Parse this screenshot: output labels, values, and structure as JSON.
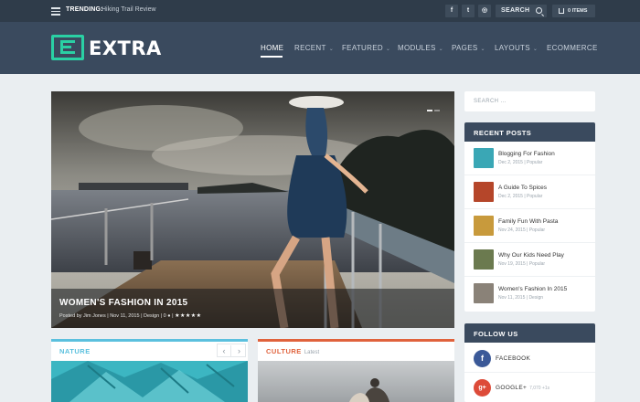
{
  "topbar": {
    "trending_label": "TRENDING:",
    "trending_text": "Hiking Trail Review",
    "social": [
      {
        "icon": "facebook-icon",
        "glyph": "f"
      },
      {
        "icon": "twitter-icon",
        "glyph": "t"
      },
      {
        "icon": "instagram-icon",
        "glyph": "◎"
      }
    ],
    "search_label": "SEARCH",
    "cart_label": "0 ITEMS"
  },
  "header": {
    "logo_text": "EXTRA",
    "accent_color": "#2ad0a4",
    "nav": [
      {
        "label": "HOME",
        "active": true,
        "dropdown": false
      },
      {
        "label": "RECENT",
        "active": false,
        "dropdown": true
      },
      {
        "label": "FEATURED",
        "active": false,
        "dropdown": true
      },
      {
        "label": "MODULES",
        "active": false,
        "dropdown": true
      },
      {
        "label": "PAGES",
        "active": false,
        "dropdown": true
      },
      {
        "label": "LAYOUTS",
        "active": false,
        "dropdown": true
      },
      {
        "label": "ECOMMERCE",
        "active": false,
        "dropdown": false
      }
    ]
  },
  "featured": {
    "title": "WOMEN'S FASHION IN 2015",
    "meta": "Posted by Jim Jones | Nov 11, 2015 | Design | 0",
    "rating_stars": "★★★★★"
  },
  "sidebar": {
    "search_placeholder": "SEARCH ...",
    "recent_posts": {
      "heading": "RECENT POSTS",
      "items": [
        {
          "title": "Blogging For Fashion",
          "meta": "Dec 2, 2015 | Popular",
          "thumb": "#3aa7b5"
        },
        {
          "title": "A Guide To Spices",
          "meta": "Dec 2, 2015 | Popular",
          "thumb": "#b5462a"
        },
        {
          "title": "Family Fun With Pasta",
          "meta": "Nov 24, 2015 | Popular",
          "thumb": "#c89a3c"
        },
        {
          "title": "Why Our Kids Need Play",
          "meta": "Nov 19, 2015 | Popular",
          "thumb": "#6b7a4f"
        },
        {
          "title": "Women's Fashion In 2015",
          "meta": "Nov 11, 2015 | Design",
          "thumb": "#8a8278"
        }
      ]
    },
    "follow": {
      "heading": "FOLLOW US",
      "items": [
        {
          "name": "FACEBOOK",
          "count": "",
          "glyph": "f",
          "color": "#3b5998"
        },
        {
          "name": "GOOGLE+",
          "count": "7,070 +1s",
          "glyph": "g+",
          "color": "#dd4b39"
        }
      ]
    }
  },
  "categories": [
    {
      "title": "NATURE",
      "subtitle": "",
      "color": "#5bc0de",
      "prev": "‹",
      "next": "›"
    },
    {
      "title": "CULTURE",
      "subtitle": "Latest",
      "color": "#e0623c"
    }
  ]
}
